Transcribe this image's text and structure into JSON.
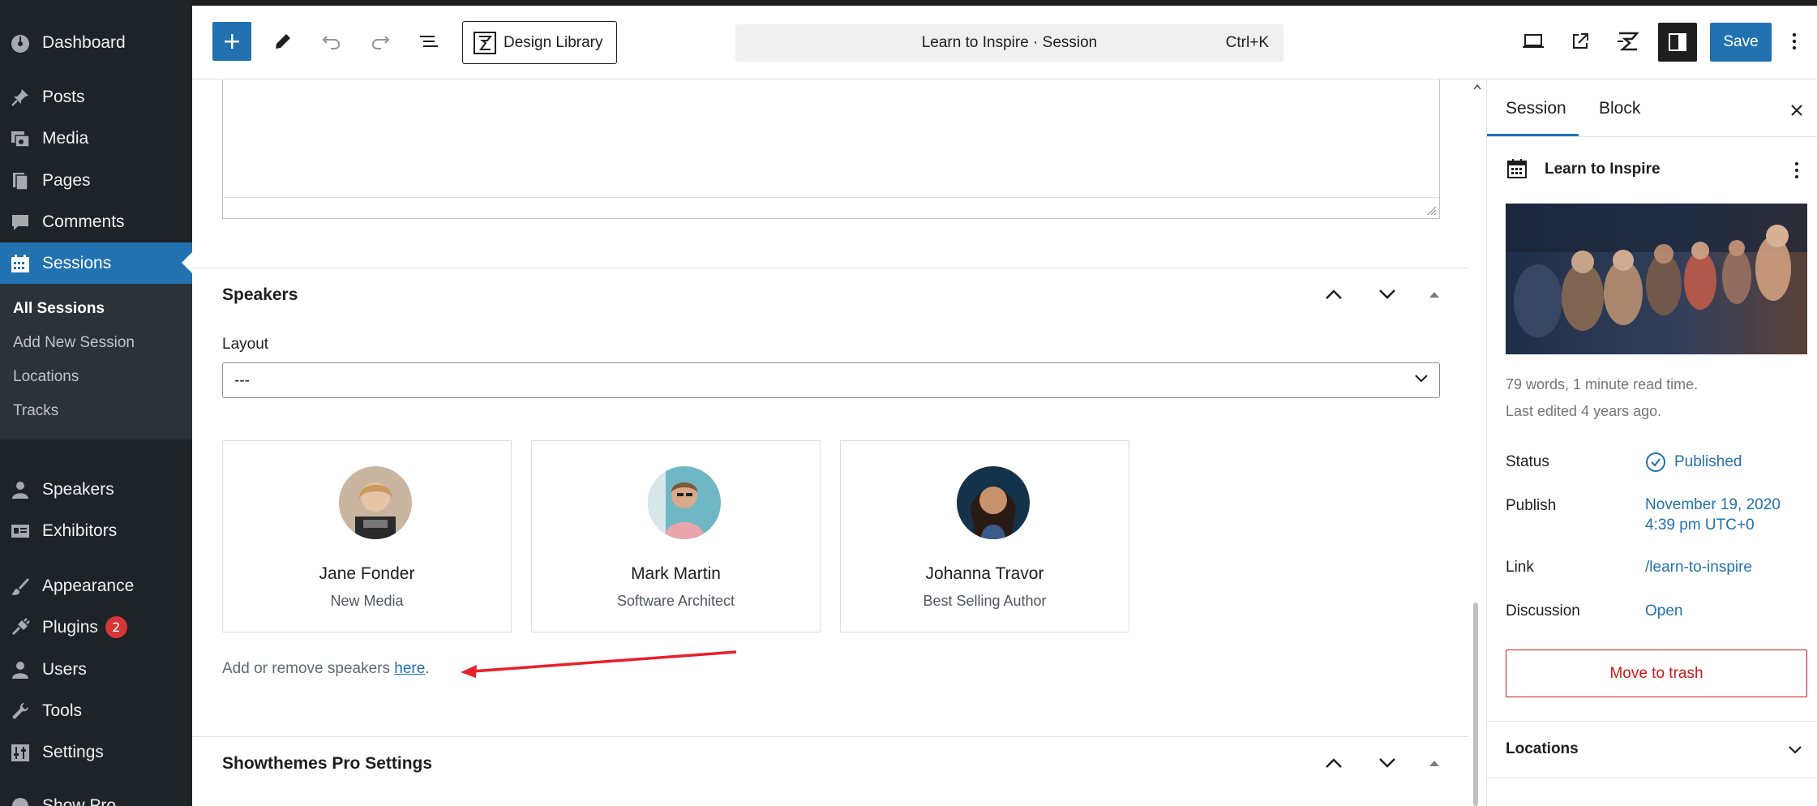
{
  "admin_menu": {
    "items": [
      {
        "label": "Dashboard",
        "icon": "dashboard-icon"
      },
      {
        "label": "Posts",
        "icon": "pin-icon"
      },
      {
        "label": "Media",
        "icon": "media-icon"
      },
      {
        "label": "Pages",
        "icon": "pages-icon"
      },
      {
        "label": "Comments",
        "icon": "comment-icon"
      },
      {
        "label": "Sessions",
        "icon": "calendar-icon"
      },
      {
        "label": "Speakers",
        "icon": "user-icon"
      },
      {
        "label": "Exhibitors",
        "icon": "id-card-icon"
      },
      {
        "label": "Appearance",
        "icon": "brush-icon"
      },
      {
        "label": "Plugins",
        "icon": "plug-icon",
        "badge": "2"
      },
      {
        "label": "Users",
        "icon": "user-icon"
      },
      {
        "label": "Tools",
        "icon": "wrench-icon"
      },
      {
        "label": "Settings",
        "icon": "sliders-icon"
      },
      {
        "label": "Show Pro",
        "icon": "show-icon"
      }
    ],
    "sessions_submenu": [
      "All Sessions",
      "Add New Session",
      "Locations",
      "Tracks"
    ]
  },
  "toolbar": {
    "design_library_label": "Design Library",
    "command_title": "Learn to Inspire · Session",
    "command_shortcut": "Ctrl+K",
    "save_label": "Save"
  },
  "editor": {
    "speakers_section_title": "Speakers",
    "layout_label": "Layout",
    "layout_value": "---",
    "speakers": [
      {
        "name": "Jane Fonder",
        "role": "New Media"
      },
      {
        "name": "Mark Martin",
        "role": "Software Architect"
      },
      {
        "name": "Johanna Travor",
        "role": "Best Selling Author"
      }
    ],
    "help_text": "Add or remove speakers ",
    "help_link": "here",
    "help_end": ".",
    "showthemes_section_title": "Showthemes Pro Settings"
  },
  "sidebar": {
    "tabs": [
      "Session",
      "Block"
    ],
    "post_title": "Learn to Inspire",
    "word_count": "79 words, 1 minute read time.",
    "last_edited": "Last edited 4 years ago.",
    "status_label": "Status",
    "status_value": "Published",
    "publish_label": "Publish",
    "publish_date": "November 19, 2020",
    "publish_time": "4:39 pm UTC+0",
    "link_label": "Link",
    "link_value": "/learn-to-inspire",
    "discussion_label": "Discussion",
    "discussion_value": "Open",
    "trash_label": "Move to trash",
    "locations_panel": "Locations"
  },
  "colors": {
    "admin_bg": "#1d2327",
    "accent": "#2271b1",
    "danger": "#cc1818",
    "annotation_arrow": "#e8202a"
  }
}
